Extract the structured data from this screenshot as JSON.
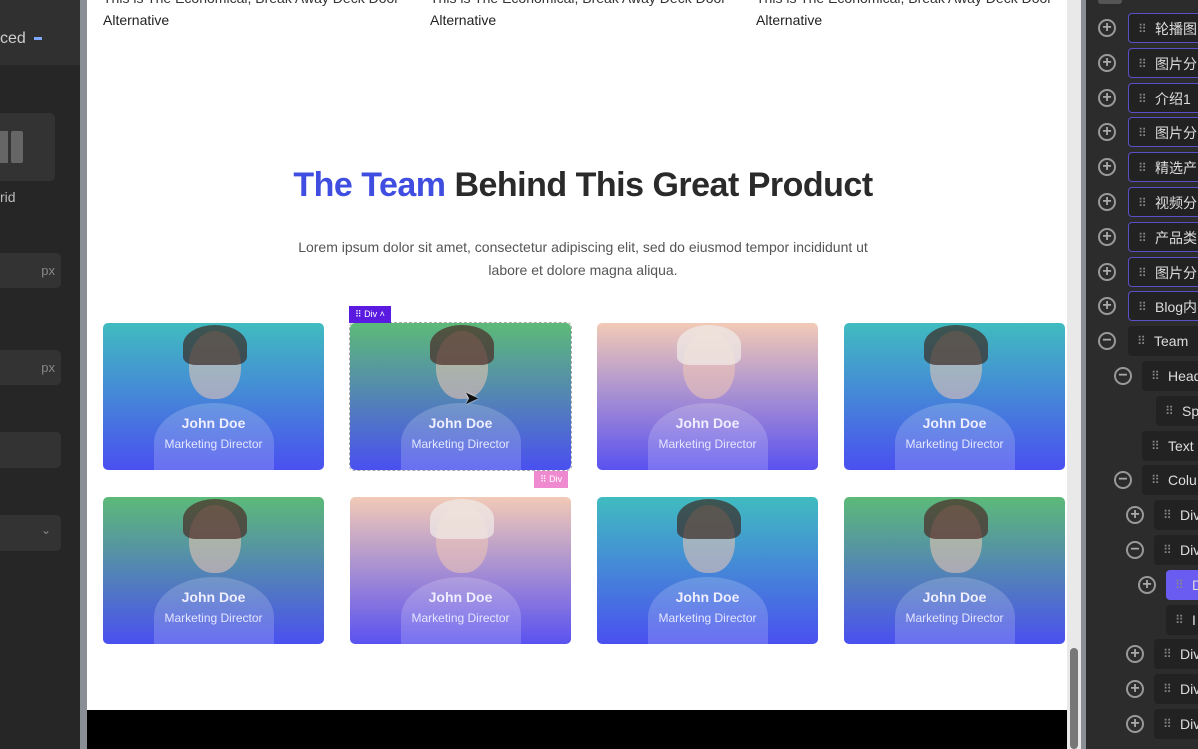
{
  "left_panel": {
    "header": "ced",
    "layout_label": "rid",
    "unit1": "px",
    "unit2": "px"
  },
  "top_cards": [
    {
      "line1": "This is The Economical, Break Away Deck Door",
      "line2": "Alternative"
    },
    {
      "line1": "This is The Economical, Break Away Deck Door",
      "line2": "Alternative"
    },
    {
      "line1": "This is The Economical, Break Away Deck Door",
      "line2": "Alternative"
    }
  ],
  "team": {
    "title_highlight": "The Team",
    "title_rest": " Behind This Great Product",
    "lead": "Lorem ipsum dolor sit amet, consectetur adipiscing elit, sed do eiusmod tempor incididunt ut labore et dolore magna aliqua.",
    "members": [
      {
        "name": "John Doe",
        "role": "Marketing Director",
        "photo": "man"
      },
      {
        "name": "John Doe",
        "role": "Marketing Director",
        "photo": "woman"
      },
      {
        "name": "John Doe",
        "role": "Marketing Director",
        "photo": "blonde"
      },
      {
        "name": "John Doe",
        "role": "Marketing Director",
        "photo": "man"
      },
      {
        "name": "John Doe",
        "role": "Marketing Director",
        "photo": "woman"
      },
      {
        "name": "John Doe",
        "role": "Marketing Director",
        "photo": "blonde"
      },
      {
        "name": "John Doe",
        "role": "Marketing Director",
        "photo": "man"
      },
      {
        "name": "John Doe",
        "role": "Marketing Director",
        "photo": "woman"
      }
    ]
  },
  "selection": {
    "tag_top": "Div",
    "tag_bottom": "Div",
    "color_top": "#5a1ae0",
    "color_bottom": "#f08ad0"
  },
  "colors": {
    "accent": "#3f4de0",
    "tree_active": "#6a5cf0"
  },
  "tree": [
    {
      "label": "轮播图",
      "level": 0,
      "toggle": "plus",
      "style": "purple"
    },
    {
      "label": "图片分",
      "level": 0,
      "toggle": "plus",
      "style": "purple"
    },
    {
      "label": "介绍1",
      "level": 0,
      "toggle": "plus",
      "style": "purple"
    },
    {
      "label": "图片分",
      "level": 0,
      "toggle": "plus",
      "style": "purple"
    },
    {
      "label": "精选产",
      "level": 0,
      "toggle": "plus",
      "style": "purple"
    },
    {
      "label": "视频分",
      "level": 0,
      "toggle": "plus",
      "style": "purple"
    },
    {
      "label": "产品类",
      "level": 0,
      "toggle": "plus",
      "style": "purple"
    },
    {
      "label": "图片分",
      "level": 0,
      "toggle": "plus",
      "style": "purple"
    },
    {
      "label": "Blog内",
      "level": 0,
      "toggle": "plus",
      "style": "purple"
    },
    {
      "label": "Team",
      "level": 0,
      "toggle": "minus",
      "style": ""
    },
    {
      "label": "Head",
      "level": 1,
      "toggle": "minus",
      "style": ""
    },
    {
      "label": "Sp",
      "level": 2,
      "toggle": "",
      "style": ""
    },
    {
      "label": "Text",
      "level": 1,
      "toggle": "",
      "style": ""
    },
    {
      "label": "Colu",
      "level": 1,
      "toggle": "minus",
      "style": ""
    },
    {
      "label": "Div",
      "level": 2,
      "toggle": "plus",
      "style": ""
    },
    {
      "label": "Div",
      "level": 2,
      "toggle": "minus",
      "style": ""
    },
    {
      "label": "D",
      "level": 3,
      "toggle": "plus",
      "style": "active"
    },
    {
      "label": "I",
      "level": 3,
      "toggle": "",
      "style": ""
    },
    {
      "label": "Div",
      "level": 2,
      "toggle": "plus",
      "style": ""
    },
    {
      "label": "Div",
      "level": 2,
      "toggle": "plus",
      "style": ""
    },
    {
      "label": "Div",
      "level": 2,
      "toggle": "plus",
      "style": ""
    }
  ]
}
